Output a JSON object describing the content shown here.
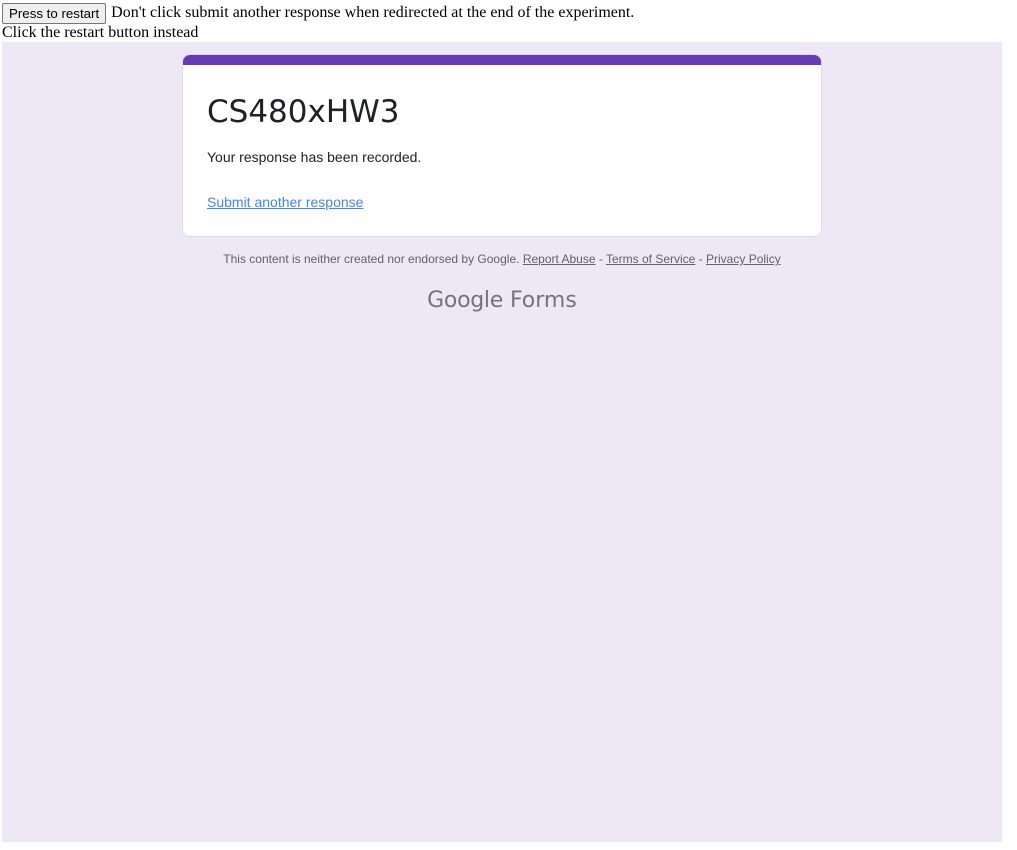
{
  "top_bar": {
    "restart_button_label": "Press to restart",
    "warning_text": "Don't click submit another response when redirected at the end of the experiment.",
    "instruction_text": "Click the restart button instead"
  },
  "form": {
    "title": "CS480xHW3",
    "confirmation_message": "Your response has been recorded.",
    "submit_another_link": "Submit another response",
    "accent_color": "#673ab7",
    "background_color": "#ede7f6",
    "link_color": "#4285f4"
  },
  "footer": {
    "disclaimer": "This content is neither created nor endorsed by Google.",
    "report_abuse": "Report Abuse",
    "separator": " - ",
    "terms_of_service": "Terms of Service",
    "privacy_policy": "Privacy Policy"
  },
  "brand": {
    "google": "Google",
    "forms": "Forms"
  }
}
